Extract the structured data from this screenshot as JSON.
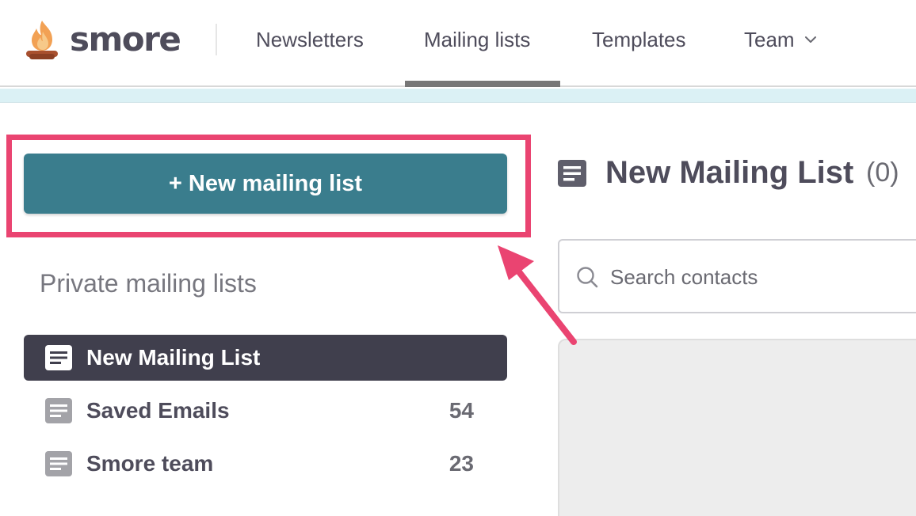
{
  "brand": {
    "name": "smore",
    "icon": "campfire-logo-icon"
  },
  "nav": {
    "items": [
      {
        "label": "Newsletters",
        "active": false
      },
      {
        "label": "Mailing lists",
        "active": true
      },
      {
        "label": "Templates",
        "active": false
      },
      {
        "label": "Team",
        "active": false,
        "has_dropdown": true
      }
    ]
  },
  "sidebar": {
    "new_button_label": "+ New mailing list",
    "section_title": "Private mailing lists",
    "lists": [
      {
        "label": "New Mailing List",
        "count": "",
        "active": true,
        "icon": "list-doc-icon"
      },
      {
        "label": "Saved Emails",
        "count": "54",
        "active": false,
        "icon": "list-doc-icon"
      },
      {
        "label": "Smore team",
        "count": "23",
        "active": false,
        "icon": "list-doc-icon"
      }
    ]
  },
  "detail": {
    "title": "New Mailing List",
    "count": "(0)",
    "search": {
      "placeholder": "Search contacts",
      "value": ""
    }
  },
  "annotation": {
    "highlight_color": "#ea4471",
    "arrow_color": "#ea4471"
  },
  "colors": {
    "primary_button": "#3a7d8d",
    "active_item": "#403f4d",
    "banner": "#dbf1f5",
    "text": "#4e4c5b"
  }
}
